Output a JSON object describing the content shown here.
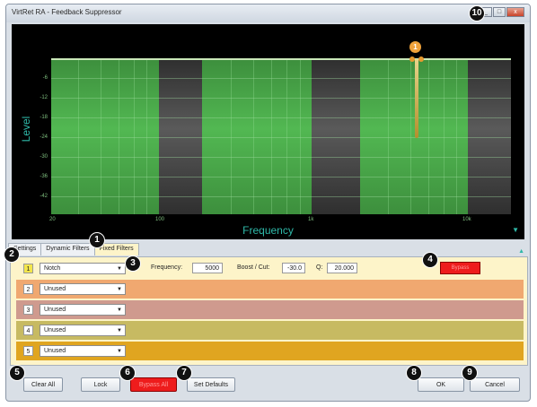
{
  "window": {
    "title": "VirtRet RA - Feedback Suppressor",
    "btn_min": "_",
    "btn_max": "□",
    "btn_close": "x"
  },
  "graph": {
    "ylabel": "Level",
    "xlabel": "Frequency",
    "yticks": [
      "-6",
      "-12",
      "-18",
      "-24",
      "-30",
      "-36",
      "-42"
    ],
    "xticks": [
      "20",
      "100",
      "1k",
      "10k"
    ],
    "marker_label": "1"
  },
  "tabs": [
    {
      "label": "Settings",
      "active": false
    },
    {
      "label": "Dynamic Filters",
      "active": false
    },
    {
      "label": "Fixed Filters",
      "active": true
    }
  ],
  "filters": [
    {
      "num": "1",
      "type": "Notch",
      "selected": true,
      "color": "#fdf4c9"
    },
    {
      "num": "2",
      "type": "Unused",
      "selected": false,
      "color": "#f0a870"
    },
    {
      "num": "3",
      "type": "Unused",
      "selected": false,
      "color": "#cf9a8e"
    },
    {
      "num": "4",
      "type": "Unused",
      "selected": false,
      "color": "#c7ba62"
    },
    {
      "num": "5",
      "type": "Unused",
      "selected": false,
      "color": "#e0a520"
    }
  ],
  "params": {
    "freq_label": "Frequency:",
    "freq_value": "5000",
    "boost_label": "Boost / Cut:",
    "boost_value": "-30.0",
    "q_label": "Q:",
    "q_value": "20.000",
    "bypass_label": "Bypass"
  },
  "buttons": {
    "clear_all": "Clear All",
    "lock": "Lock",
    "bypass_all": "Bypass All",
    "set_defaults": "Set Defaults",
    "ok": "OK",
    "cancel": "Cancel"
  },
  "callouts": [
    "1",
    "2",
    "3",
    "4",
    "5",
    "6",
    "7",
    "8",
    "9",
    "10"
  ]
}
